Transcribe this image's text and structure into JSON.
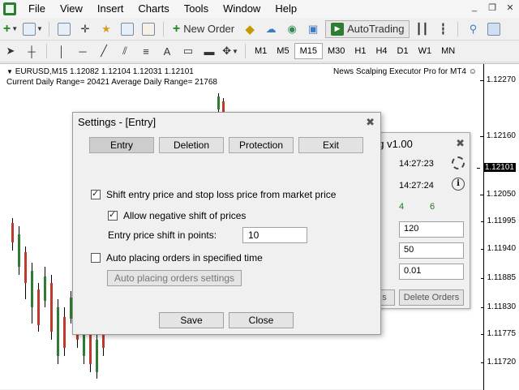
{
  "menu": {
    "items": [
      "File",
      "View",
      "Insert",
      "Charts",
      "Tools",
      "Window",
      "Help"
    ]
  },
  "toolbar": {
    "new_order": "New Order",
    "autotrading": "AutoTrading",
    "timeframes": [
      "M1",
      "M5",
      "M15",
      "M30",
      "H1",
      "H4",
      "D1",
      "W1",
      "MN"
    ],
    "active_timeframe": "M15"
  },
  "chart": {
    "symbol_line": "EURUSD,M15  1.12082 1.12104 1.12031 1.12101",
    "range_line": "Current Daily Range= 20421   Average Daily Range= 21768",
    "ea_name": "News Scalping Executor Pro for MT4",
    "price_labels": [
      "1.12270",
      "1.12160",
      "1.12101",
      "1.12050",
      "1.11995",
      "1.11940",
      "1.11885",
      "1.11830",
      "1.11775",
      "1.11720"
    ],
    "current_price": "1.12101"
  },
  "ea_panel": {
    "title_partial": "ng v1.00",
    "time1": "14:27:23",
    "time2": "14:27:24",
    "num1": "4",
    "num2": "6",
    "input1": "120",
    "input2": "50",
    "input3": "0.01",
    "btn_partial": "s",
    "delete_orders": "Delete Orders"
  },
  "dialog": {
    "title": "Settings - [Entry]",
    "tabs": [
      "Entry",
      "Deletion",
      "Protection",
      "Exit"
    ],
    "active_tab": "Entry",
    "shift_entry_label": "Shift entry price and stop loss price from market price",
    "shift_entry_checked": true,
    "allow_negative_label": "Allow negative shift of prices",
    "allow_negative_checked": true,
    "shift_points_label": "Entry price shift in points:",
    "shift_points_value": "10",
    "auto_place_label": "Auto placing orders in specified time",
    "auto_place_checked": false,
    "auto_place_settings": "Auto placing orders settings",
    "save": "Save",
    "close": "Close"
  }
}
